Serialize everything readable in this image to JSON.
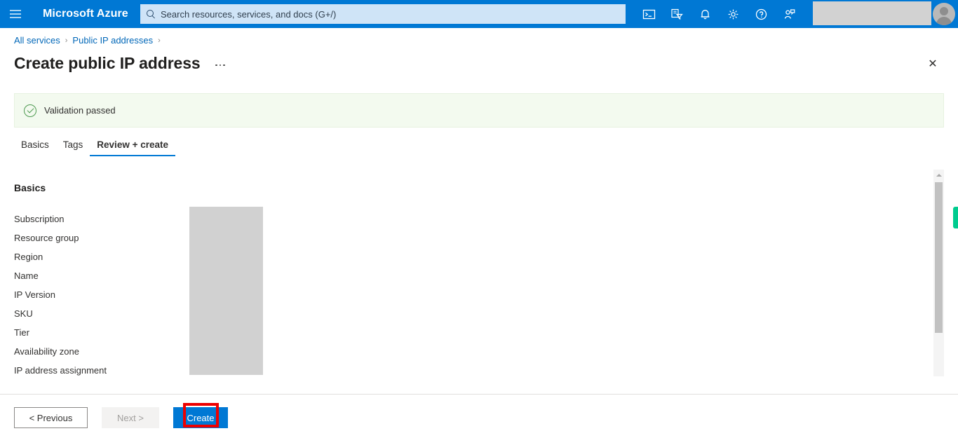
{
  "header": {
    "menu_icon": "hamburger-icon",
    "brand": "Microsoft Azure",
    "search_placeholder": "Search resources, services, and docs (G+/)",
    "icons": [
      {
        "name": "cloud-shell-icon",
        "title": "Cloud Shell"
      },
      {
        "name": "directory-filter-icon",
        "title": "Directories + subscriptions"
      },
      {
        "name": "notifications-bell-icon",
        "title": "Notifications"
      },
      {
        "name": "settings-gear-icon",
        "title": "Settings"
      },
      {
        "name": "help-question-icon",
        "title": "Help"
      },
      {
        "name": "feedback-person-icon",
        "title": "Feedback"
      }
    ],
    "accent_color": "#0078d4"
  },
  "breadcrumb": {
    "items": [
      "All services",
      "Public IP addresses"
    ],
    "separator": "›"
  },
  "page": {
    "title": "Create public IP address",
    "more_menu": "…",
    "close": "✕"
  },
  "banner": {
    "icon": "check-circle-icon",
    "text": "Validation passed",
    "background": "#f3faef",
    "icon_color": "#4e9a51"
  },
  "tabs": [
    {
      "label": "Basics",
      "active": false
    },
    {
      "label": "Tags",
      "active": false
    },
    {
      "label": "Review + create",
      "active": true
    }
  ],
  "main": {
    "section_title": "Basics",
    "fields": [
      {
        "label": "Subscription",
        "value": ""
      },
      {
        "label": "Resource group",
        "value": ""
      },
      {
        "label": "Region",
        "value": ""
      },
      {
        "label": "Name",
        "value": ""
      },
      {
        "label": "IP Version",
        "value": ""
      },
      {
        "label": "SKU",
        "value": ""
      },
      {
        "label": "Tier",
        "value": ""
      },
      {
        "label": "Availability zone",
        "value": ""
      },
      {
        "label": "IP address assignment",
        "value": ""
      }
    ],
    "values_redacted": true
  },
  "footer": {
    "previous_label": "< Previous",
    "next_label": "Next >",
    "create_label": "Create",
    "next_disabled": true,
    "create_highlight_color": "#ee0000"
  },
  "scrollbar": {
    "visible": true
  }
}
